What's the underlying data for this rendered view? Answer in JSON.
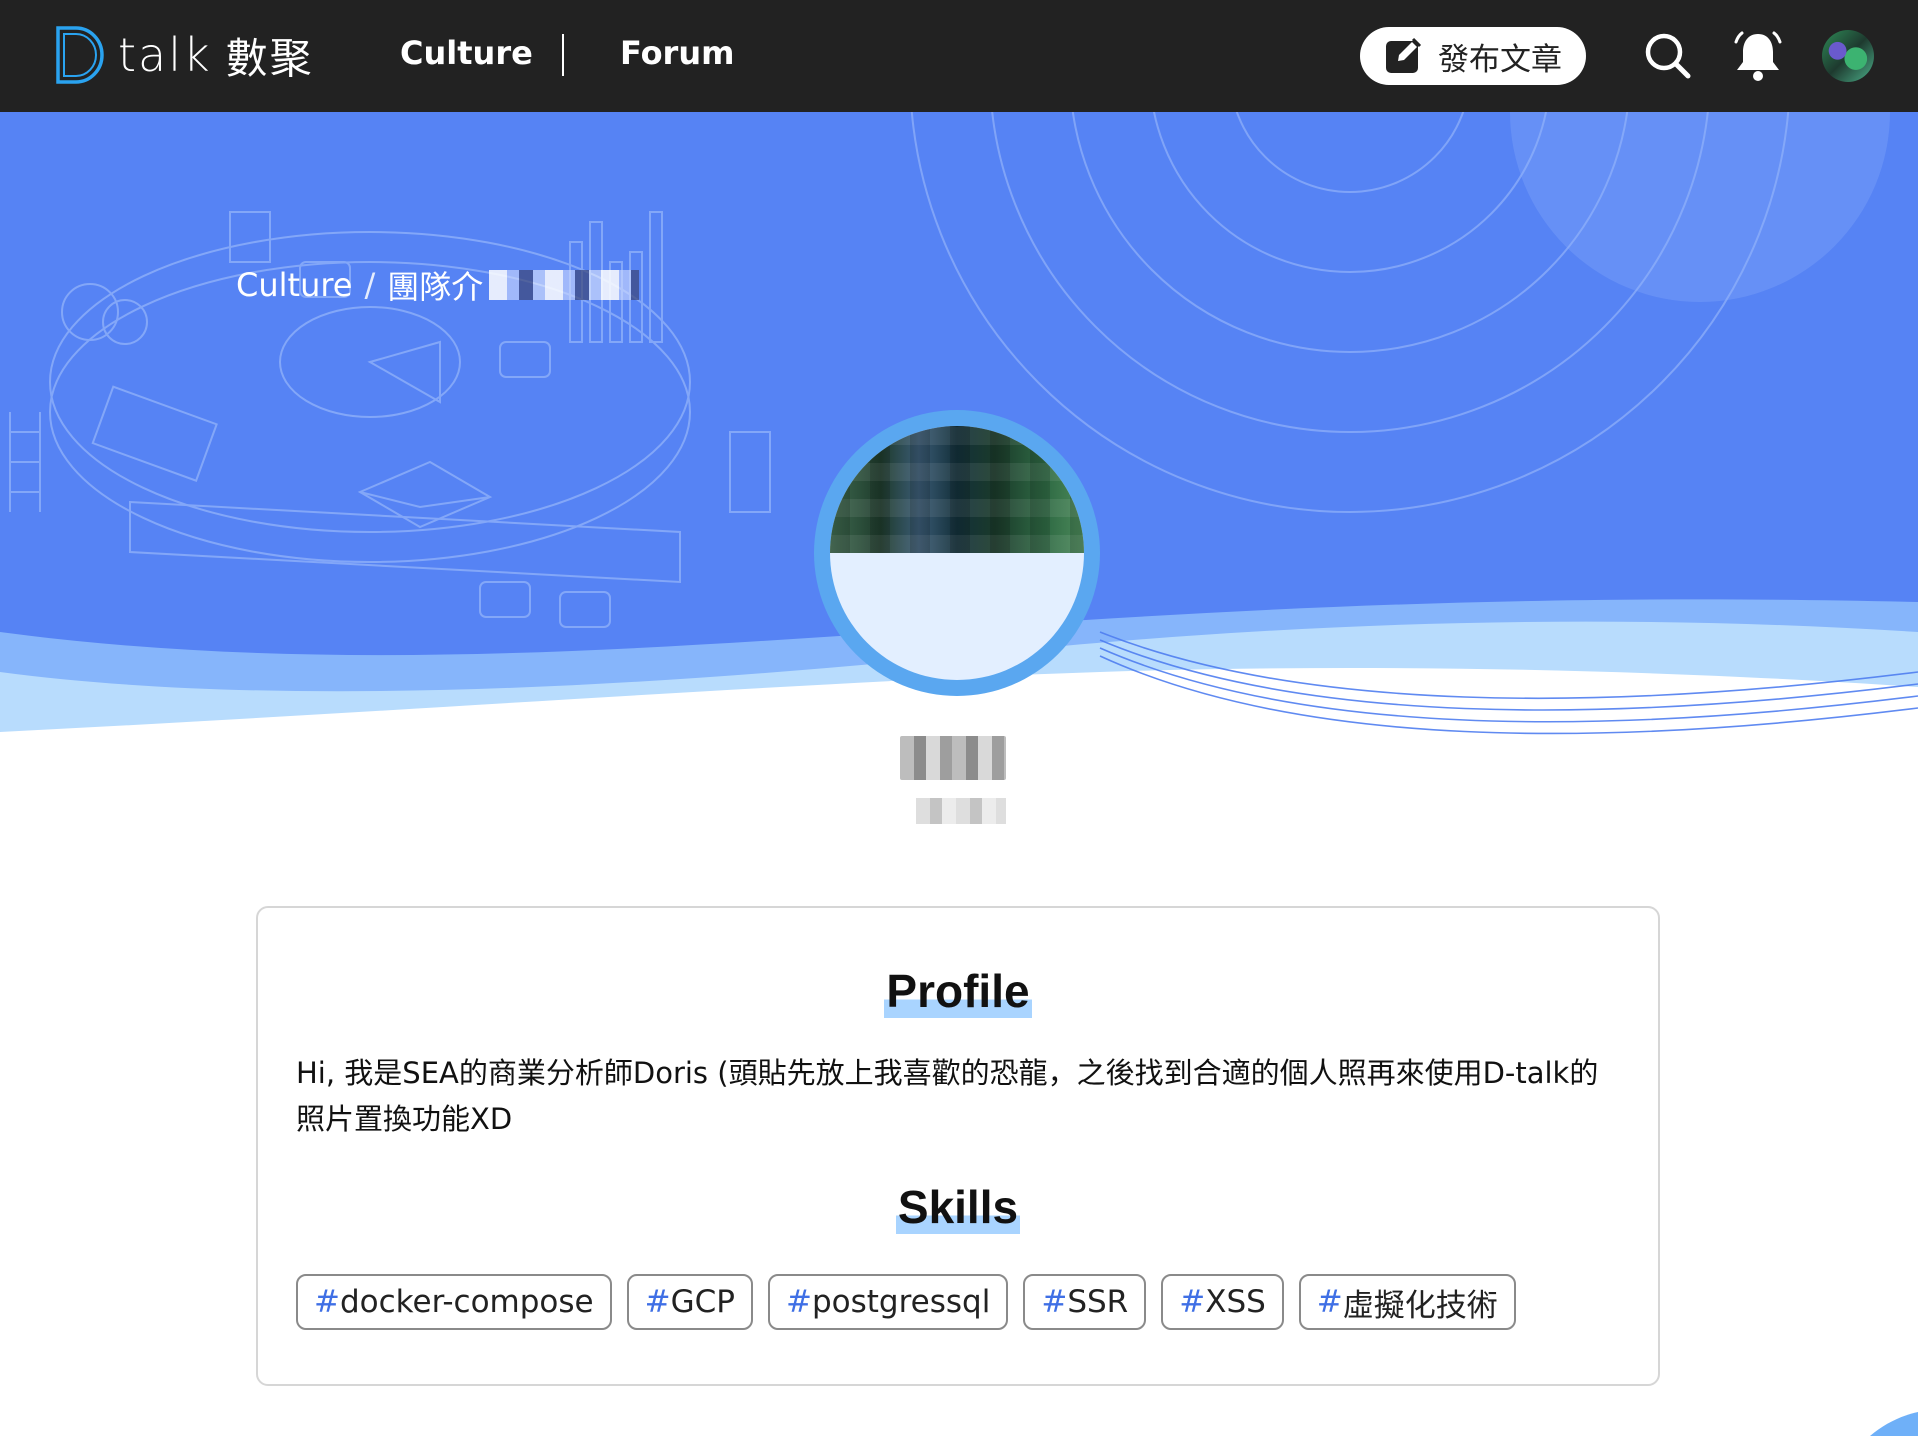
{
  "nav": {
    "logo_text": "talk",
    "logo_cn": "數聚",
    "links": [
      {
        "label": "Culture"
      },
      {
        "label": "Forum"
      }
    ],
    "publish_label": "發布文章"
  },
  "hero": {
    "breadcrumb": {
      "root": "Culture",
      "separator": "/",
      "current": "團隊介"
    }
  },
  "profile": {
    "title": "Profile",
    "bio": "Hi, 我是SEA的商業分析師Doris (頭貼先放上我喜歡的恐龍，之後找到合適的個人照再來使用D-talk的照片置換功能XD",
    "skills_title": "Skills",
    "tag_hash": "#",
    "tags": [
      "docker-compose",
      "GCP",
      "postgressql",
      "SSR",
      "XSS",
      "虛擬化技術"
    ]
  },
  "colors": {
    "nav_bg": "#222222",
    "hero_blue": "#5683f4",
    "avatar_ring": "#5aa7f0",
    "tag_hash": "#3f6fe5",
    "title_highlight": "#a9d4ff"
  },
  "icons": {
    "logo": "d-logo-icon",
    "publish": "edit-pen-icon",
    "search": "search-icon",
    "bell": "bell-icon"
  }
}
